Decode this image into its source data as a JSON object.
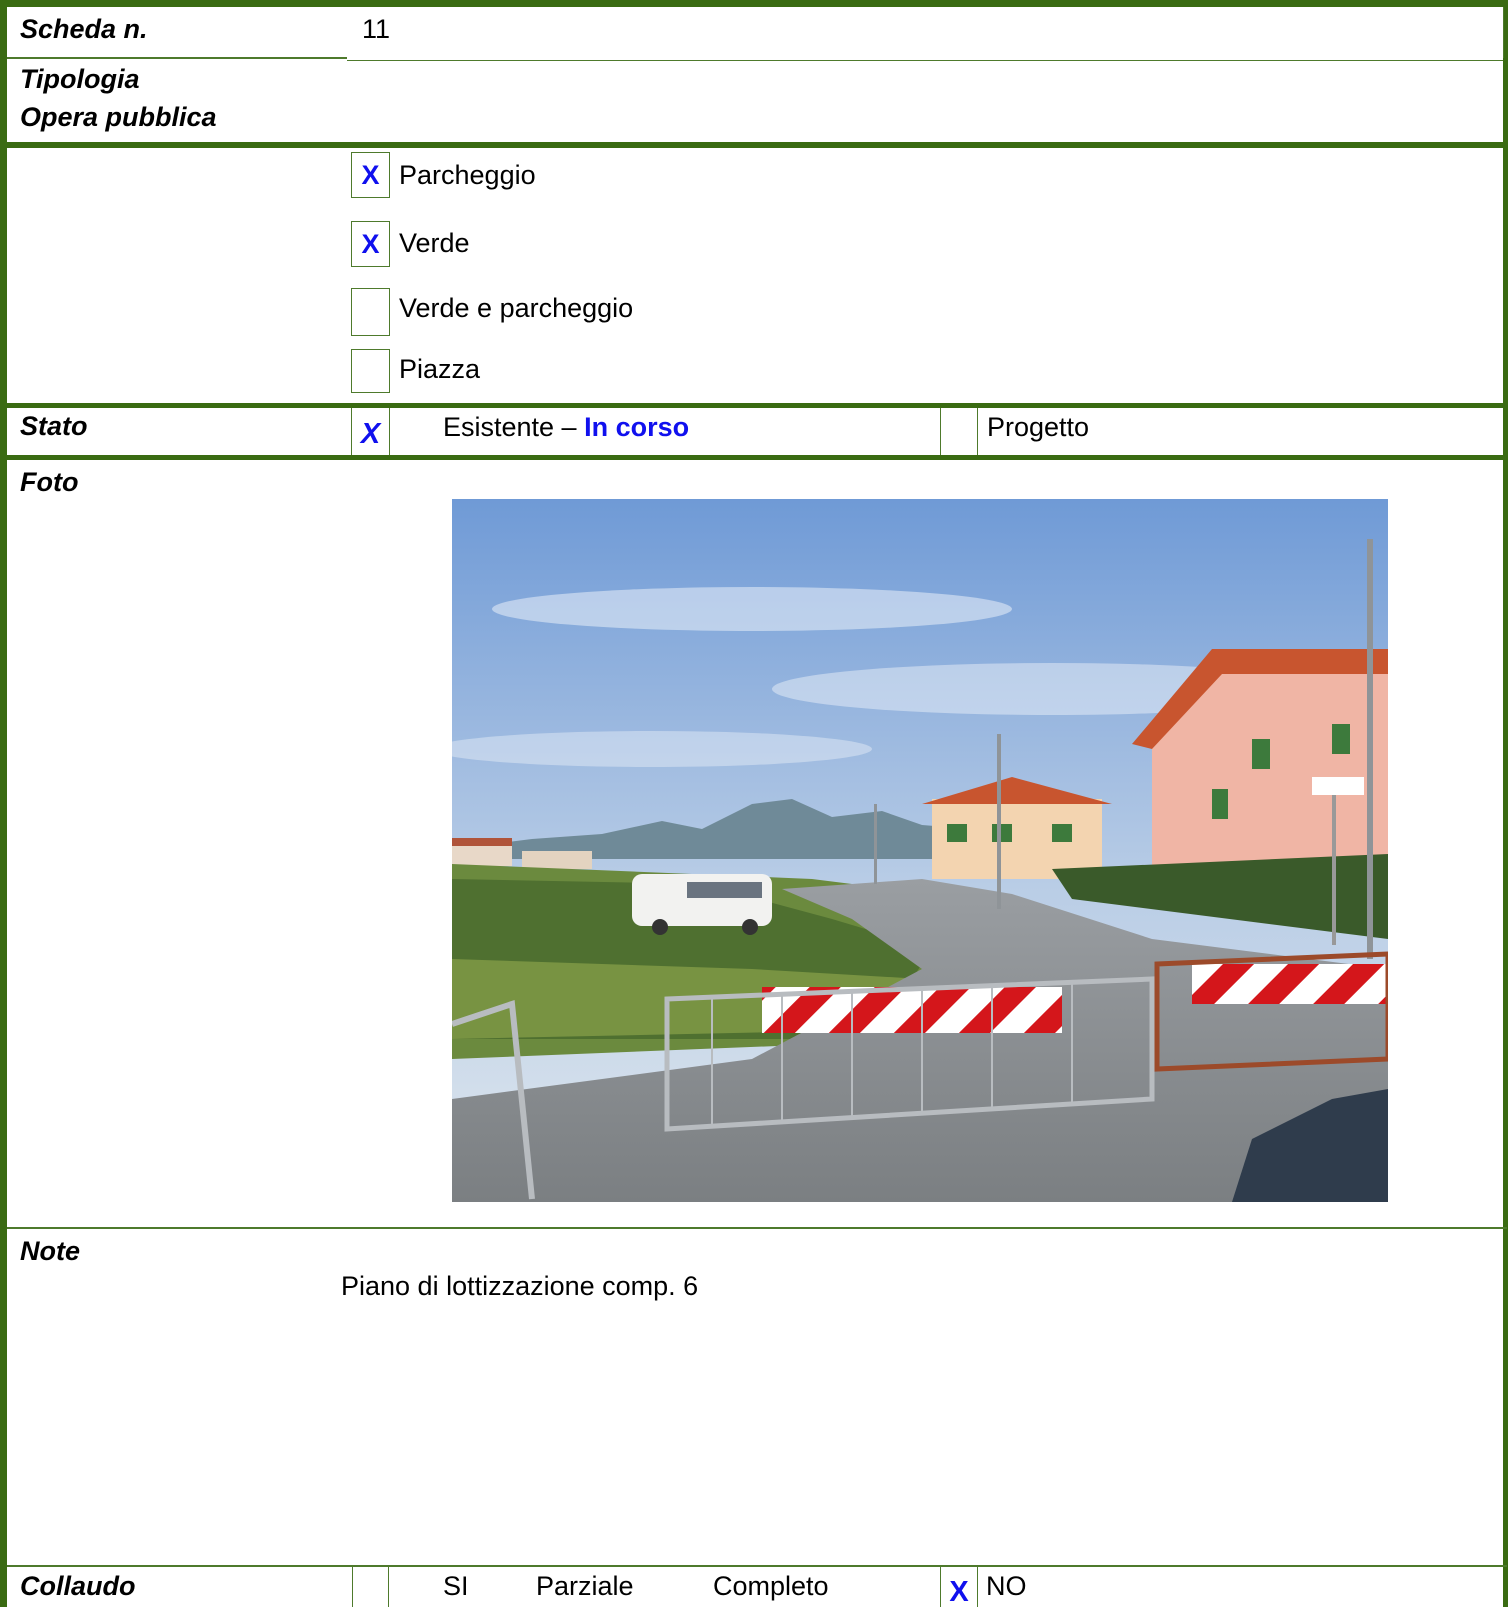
{
  "scheda": {
    "label": "Scheda n.",
    "value": "11"
  },
  "tipologia": {
    "label_line1": "Tipologia",
    "label_line2": "Opera pubblica",
    "options": [
      {
        "label": "Parcheggio",
        "checked": true,
        "mark": "X"
      },
      {
        "label": "Verde",
        "checked": true,
        "mark": "X"
      },
      {
        "label": "Verde e parcheggio",
        "checked": false,
        "mark": ""
      },
      {
        "label": "Piazza",
        "checked": false,
        "mark": ""
      }
    ]
  },
  "stato": {
    "label": "Stato",
    "esistente_mark": "X",
    "esistente_text": "Esistente –",
    "in_corso_text": "In corso",
    "progetto_mark": "",
    "progetto_text": "Progetto"
  },
  "foto": {
    "label": "Foto"
  },
  "note": {
    "label": "Note",
    "text": "Piano di lottizzazione comp. 6"
  },
  "collaudo": {
    "label": "Collaudo",
    "si_mark": "",
    "si_text": "SI",
    "parziale_text": "Parziale",
    "completo_text": "Completo",
    "no_mark": "X",
    "no_text": "NO"
  },
  "colors": {
    "border": "#3a6b12",
    "mark": "#1010ee"
  }
}
